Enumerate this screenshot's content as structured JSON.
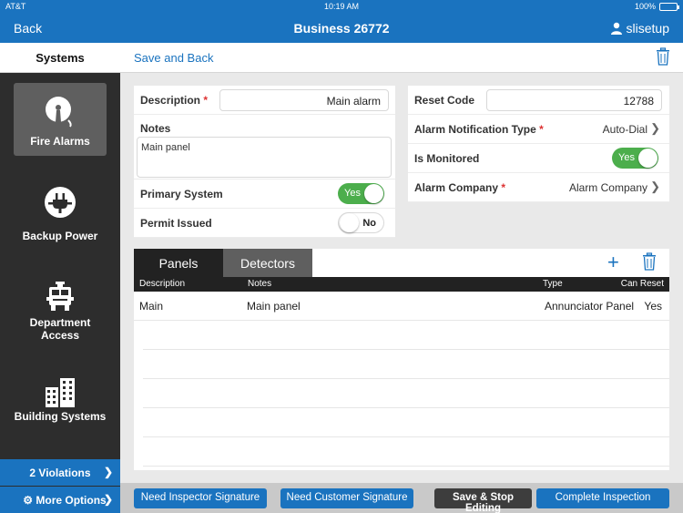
{
  "status": {
    "carrier": "AT&T",
    "time": "10:19 AM",
    "battery": "100%"
  },
  "nav": {
    "back": "Back",
    "title": "Business 26772",
    "user": "slisetup"
  },
  "subheader": {
    "section": "Systems",
    "save_back": "Save and Back"
  },
  "sidebar": {
    "items": [
      {
        "label": "Fire Alarms",
        "icon": "bell-icon",
        "active": true
      },
      {
        "label": "Backup Power",
        "icon": "plug-icon",
        "active": false
      },
      {
        "label": "Department Access",
        "icon": "fire-truck-icon",
        "active": false
      },
      {
        "label": "Building Systems",
        "icon": "buildings-icon",
        "active": false
      }
    ],
    "violations": "2 Violations",
    "more_options": "More Options"
  },
  "form_left": {
    "description_label": "Description",
    "description_value": "Main alarm",
    "notes_label": "Notes",
    "notes_value": "Main panel",
    "primary_label": "Primary System",
    "primary_value": "Yes",
    "permit_label": "Permit Issued",
    "permit_value": "No"
  },
  "form_right": {
    "reset_label": "Reset Code",
    "reset_value": "12788",
    "notif_label": "Alarm Notification Type",
    "notif_value": "Auto-Dial",
    "monitored_label": "Is Monitored",
    "monitored_value": "Yes",
    "company_label": "Alarm Company",
    "company_value": "Alarm Company"
  },
  "tabs": {
    "panels": "Panels",
    "detectors": "Detectors"
  },
  "table": {
    "columns": [
      "Description",
      "Notes",
      "Type",
      "Can Reset"
    ],
    "rows": [
      {
        "description": "Main",
        "notes": "Main panel",
        "type": "Annunciator Panel",
        "can_reset": "Yes"
      }
    ]
  },
  "bottom": {
    "inspector_sig": "Need Inspector Signature",
    "customer_sig": "Need Customer Signature",
    "save_stop": "Save & Stop Editing",
    "complete": "Complete Inspection"
  },
  "colors": {
    "brand_blue": "#1a73bf",
    "toggle_green": "#4cae4c",
    "sidebar_dark": "#2d2d2d"
  }
}
